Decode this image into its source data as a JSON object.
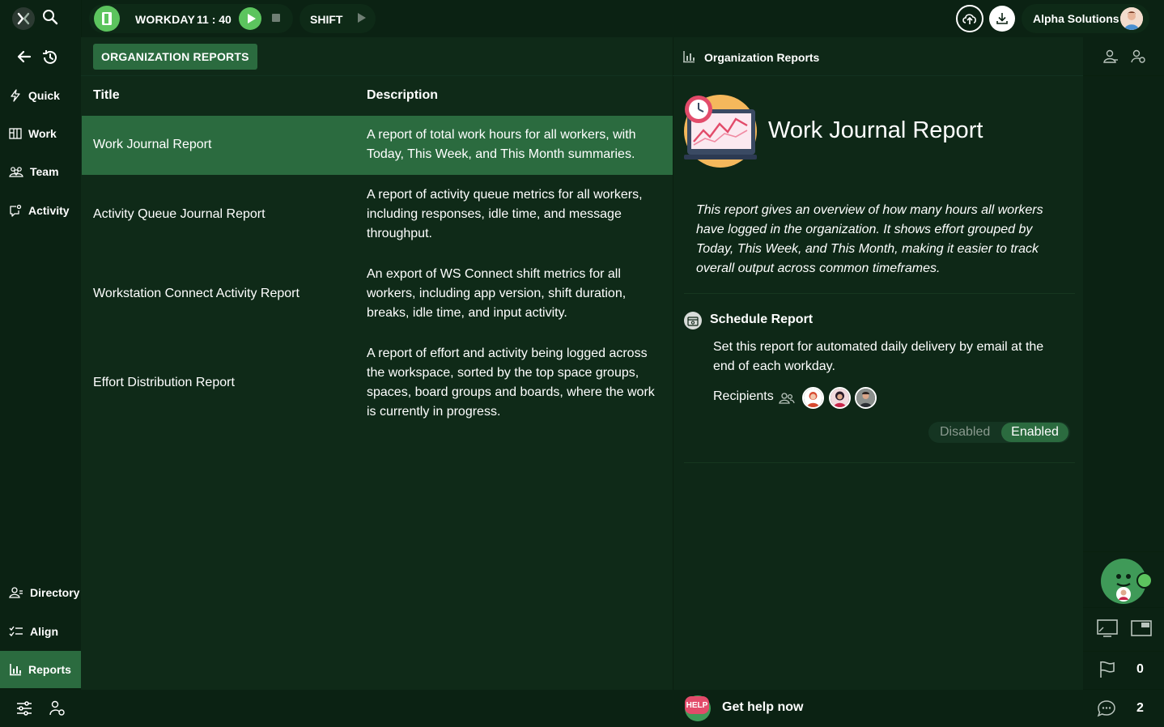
{
  "topbar": {
    "workday_label": "WORKDAY",
    "workday_time": "11 : 40",
    "shift_label": "SHIFT",
    "user_name": "Alpha Solutions"
  },
  "sidebar": {
    "items": [
      {
        "label": "Quick",
        "icon": "bolt-icon"
      },
      {
        "label": "Work",
        "icon": "board-icon"
      },
      {
        "label": "Team",
        "icon": "team-icon"
      },
      {
        "label": "Activity",
        "icon": "activity-icon"
      }
    ],
    "bottom_items": [
      {
        "label": "Directory",
        "icon": "directory-icon"
      },
      {
        "label": "Align",
        "icon": "align-icon"
      },
      {
        "label": "Reports",
        "icon": "reports-icon",
        "active": true
      }
    ]
  },
  "main": {
    "tab_label": "ORGANIZATION REPORTS",
    "columns": {
      "title": "Title",
      "description": "Description"
    },
    "rows": [
      {
        "title": "Work Journal Report",
        "description": "A report of total work hours for all workers, with Today, This Week, and This Month summaries.",
        "selected": true
      },
      {
        "title": "Activity Queue Journal Report",
        "description": "A report of activity queue metrics for all workers, including responses, idle time, and message throughput."
      },
      {
        "title": "Workstation Connect Activity Report",
        "description": "An export of WS Connect shift metrics for all workers, including app version, shift duration, breaks, idle time, and input activity."
      },
      {
        "title": "Effort Distribution Report",
        "description": "A report of effort and activity being logged across the workspace, sorted by the top space groups, spaces, board groups and boards, where the work is currently in progress."
      }
    ]
  },
  "detail": {
    "header_label": "Organization Reports",
    "title": "Work Journal Report",
    "description": "This report gives an overview of how many hours all workers have logged in the organization. It shows effort grouped by Today, This Week, and This Month, making it easier to track overall output across common timeframes.",
    "schedule_title": "Schedule Report",
    "schedule_description": "Set this report for automated daily delivery by email at the end of each workday.",
    "recipients_label": "Recipients",
    "toggle_off": "Disabled",
    "toggle_on": "Enabled"
  },
  "rail": {
    "flag_count": "0",
    "chat_count": "2"
  },
  "bottombar": {
    "help_badge": "HELP",
    "help_text": "Get help now"
  },
  "colors": {
    "background": "#0f2a18",
    "sidebar": "#0b2213",
    "accent": "#2b6b3f",
    "brand_green": "#5cc45e"
  }
}
